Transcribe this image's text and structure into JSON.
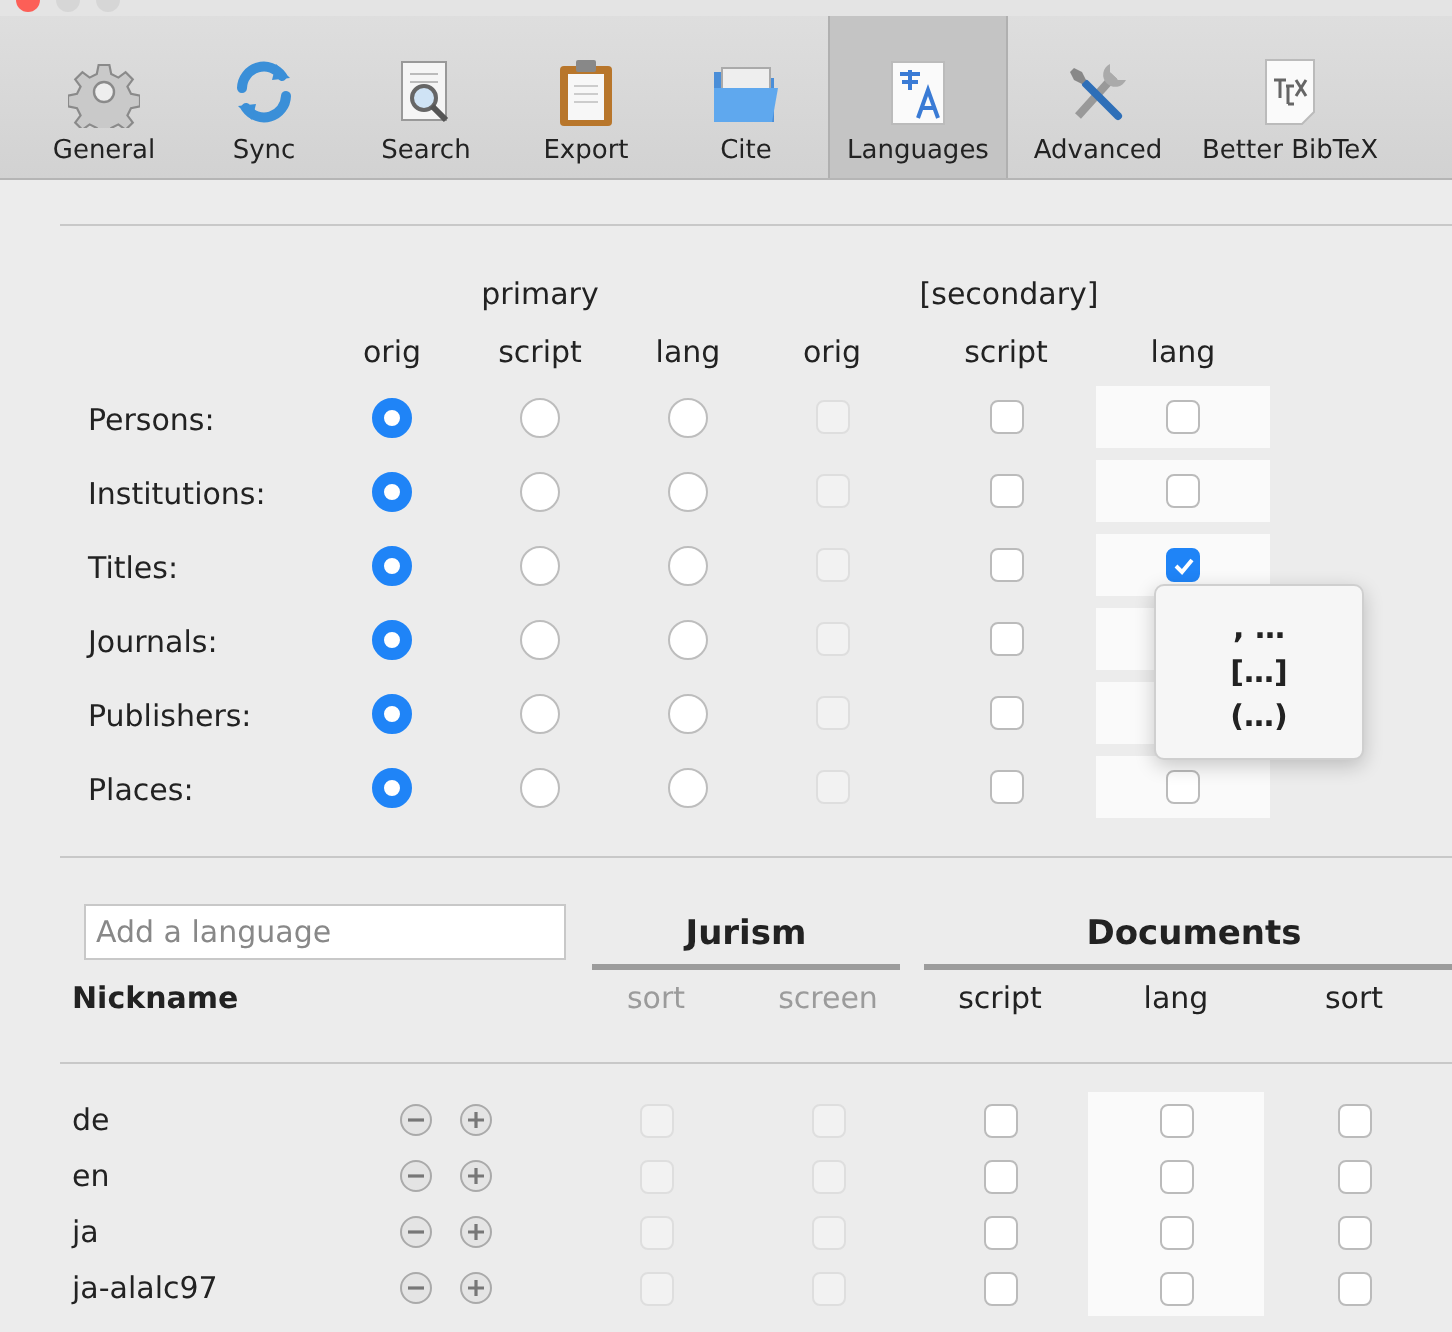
{
  "toolbar": [
    {
      "label": "General",
      "selected": false
    },
    {
      "label": "Sync",
      "selected": false
    },
    {
      "label": "Search",
      "selected": false
    },
    {
      "label": "Export",
      "selected": false
    },
    {
      "label": "Cite",
      "selected": false
    },
    {
      "label": "Languages",
      "selected": true
    },
    {
      "label": "Advanced",
      "selected": false
    },
    {
      "label": "Better BibTeX",
      "selected": false
    }
  ],
  "name_forms": {
    "group_headers": [
      "primary",
      "[secondary]"
    ],
    "columns": [
      "orig",
      "script",
      "lang",
      "orig",
      "script",
      "lang"
    ],
    "rows": [
      {
        "label": "Persons:",
        "primary": [
          {
            "selected": true
          },
          {
            "selected": false
          },
          {
            "selected": false
          }
        ],
        "secondary": [
          {
            "checked": false,
            "disabled": true
          },
          {
            "checked": false,
            "disabled": false
          }
        ],
        "secondary_lang": {
          "checked": false
        }
      },
      {
        "label": "Institutions:",
        "primary": [
          {
            "selected": true
          },
          {
            "selected": false
          },
          {
            "selected": false
          }
        ],
        "secondary": [
          {
            "checked": false,
            "disabled": true
          },
          {
            "checked": false,
            "disabled": false
          }
        ],
        "secondary_lang": {
          "checked": false
        }
      },
      {
        "label": "Titles:",
        "primary": [
          {
            "selected": true
          },
          {
            "selected": false
          },
          {
            "selected": false
          }
        ],
        "secondary": [
          {
            "checked": false,
            "disabled": true
          },
          {
            "checked": false,
            "disabled": false
          }
        ],
        "secondary_lang": {
          "checked": true
        }
      },
      {
        "label": "Journals:",
        "primary": [
          {
            "selected": true
          },
          {
            "selected": false
          },
          {
            "selected": false
          }
        ],
        "secondary": [
          {
            "checked": false,
            "disabled": true
          },
          {
            "checked": false,
            "disabled": false
          }
        ]
      },
      {
        "label": "Publishers:",
        "primary": [
          {
            "selected": true
          },
          {
            "selected": false
          },
          {
            "selected": false
          }
        ],
        "secondary": [
          {
            "checked": false,
            "disabled": true
          },
          {
            "checked": false,
            "disabled": false
          }
        ]
      },
      {
        "label": "Places:",
        "primary": [
          {
            "selected": true
          },
          {
            "selected": false
          },
          {
            "selected": false
          }
        ],
        "secondary": [
          {
            "checked": false,
            "disabled": true
          },
          {
            "checked": false,
            "disabled": false
          }
        ],
        "secondary_lang": {
          "checked": false
        }
      }
    ]
  },
  "popup_menu": {
    "items": [
      ", …",
      "[…]",
      "(…)"
    ]
  },
  "languages": {
    "search": {
      "placeholder": "Add a language"
    },
    "groups": [
      "Jurism",
      "Documents"
    ],
    "nickname_header": "Nickname",
    "columns": [
      {
        "label": "sort",
        "disabled": true
      },
      {
        "label": "screen",
        "disabled": true
      },
      {
        "label": "script",
        "disabled": false
      },
      {
        "label": "lang",
        "disabled": false
      },
      {
        "label": "sort",
        "disabled": false
      }
    ],
    "rows": [
      {
        "nickname": "de",
        "options": [
          {
            "checked": false,
            "disabled": true
          },
          {
            "checked": false,
            "disabled": true
          },
          {
            "checked": false,
            "disabled": false
          },
          {
            "checked": false,
            "disabled": false
          },
          {
            "checked": false,
            "disabled": false
          }
        ]
      },
      {
        "nickname": "en",
        "options": [
          {
            "checked": false,
            "disabled": true
          },
          {
            "checked": false,
            "disabled": true
          },
          {
            "checked": false,
            "disabled": false
          },
          {
            "checked": false,
            "disabled": false
          },
          {
            "checked": false,
            "disabled": false
          }
        ]
      },
      {
        "nickname": "ja",
        "options": [
          {
            "checked": false,
            "disabled": true
          },
          {
            "checked": false,
            "disabled": true
          },
          {
            "checked": false,
            "disabled": false
          },
          {
            "checked": false,
            "disabled": false
          },
          {
            "checked": false,
            "disabled": false
          }
        ]
      },
      {
        "nickname": "ja-alalc97",
        "options": [
          {
            "checked": false,
            "disabled": true
          },
          {
            "checked": false,
            "disabled": true
          },
          {
            "checked": false,
            "disabled": false
          },
          {
            "checked": false,
            "disabled": false
          },
          {
            "checked": false,
            "disabled": false
          }
        ]
      }
    ]
  }
}
